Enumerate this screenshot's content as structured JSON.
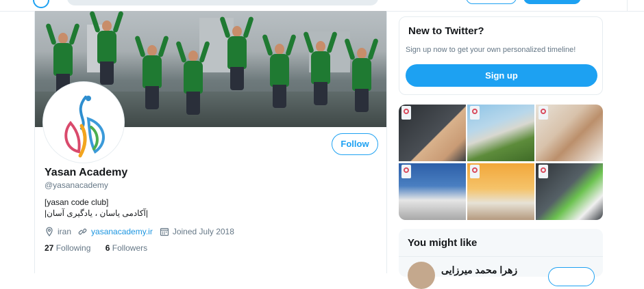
{
  "profile": {
    "name": "Yasan Academy",
    "handle": "@yasanacademy",
    "bio_line1": "[yasan code club]",
    "bio_line2": "|آکادمی یاسان ، یادگیری آسان|",
    "location": "iran",
    "website": "yasanacademy.ir",
    "joined": "Joined July 2018",
    "following_count": "27",
    "following_label": "Following",
    "followers_count": "6",
    "followers_label": "Followers",
    "follow_label": "Follow"
  },
  "signup_card": {
    "title": "New to Twitter?",
    "subtitle": "Sign up now to get your own personalized timeline!",
    "button_label": "Sign up"
  },
  "might_like": {
    "title": "You might like",
    "first_account_name": "زهرا محمد میرزایی"
  },
  "icons": {
    "location": "location-pin-icon",
    "link": "link-icon",
    "calendar": "calendar-icon"
  },
  "colors": {
    "accent": "#1da1f2",
    "link": "#1b95e0",
    "text": "#14171a",
    "muted": "#657786",
    "banner_shirt": "#1f7a32"
  }
}
